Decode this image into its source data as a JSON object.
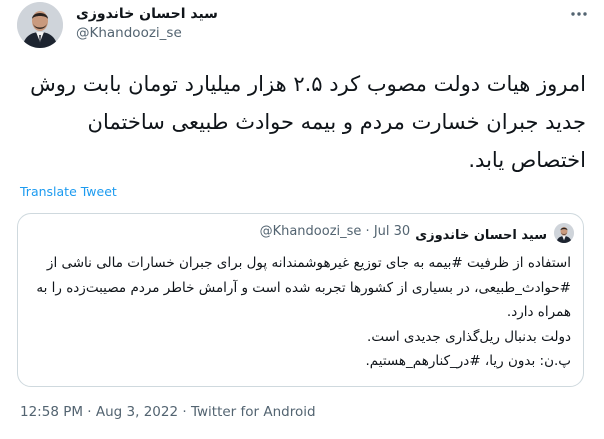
{
  "author": {
    "display_name": "سید احسان خاندوزی",
    "handle": "@Khandoozi_se"
  },
  "more_icon": "more-horizontal-icon",
  "tweet": {
    "text": "امروز هیات دولت مصوب کرد ۲.۵ هزار میلیارد تومان بابت روش جدید جبران خسارت مردم و بیمه حوادث طبیعی ساختمان اختصاص یابد.",
    "translate_label": "Translate Tweet"
  },
  "quoted_tweet": {
    "display_name": "سید احسان خاندوزی",
    "handle": "@Khandoozi_se",
    "separator": "·",
    "date": "Jul 30",
    "paragraph_1": "استفاده از ظرفیت #بیمه به جای توزیع غیرهوشمندانه پول برای جبران خسارات مالی ناشی از #حوادث_طبیعی، در بسیاری از کشورها تجربه شده است و آرامش خاطر مردم مصیبت‌زده را به همراه دارد.",
    "paragraph_2": "دولت بدنبال ریل‌گذاری جدیدی است.",
    "paragraph_3": "پ.ن: بدون ریا، #در_کنارهم_هستیم."
  },
  "footer": {
    "time": "12:58 PM",
    "sep1": "·",
    "date": "Aug 3, 2022",
    "sep2": "·",
    "source": "Twitter for Android"
  },
  "colors": {
    "link": "#1d9bf0",
    "secondary_text": "#536471",
    "border": "#cfd9de"
  }
}
